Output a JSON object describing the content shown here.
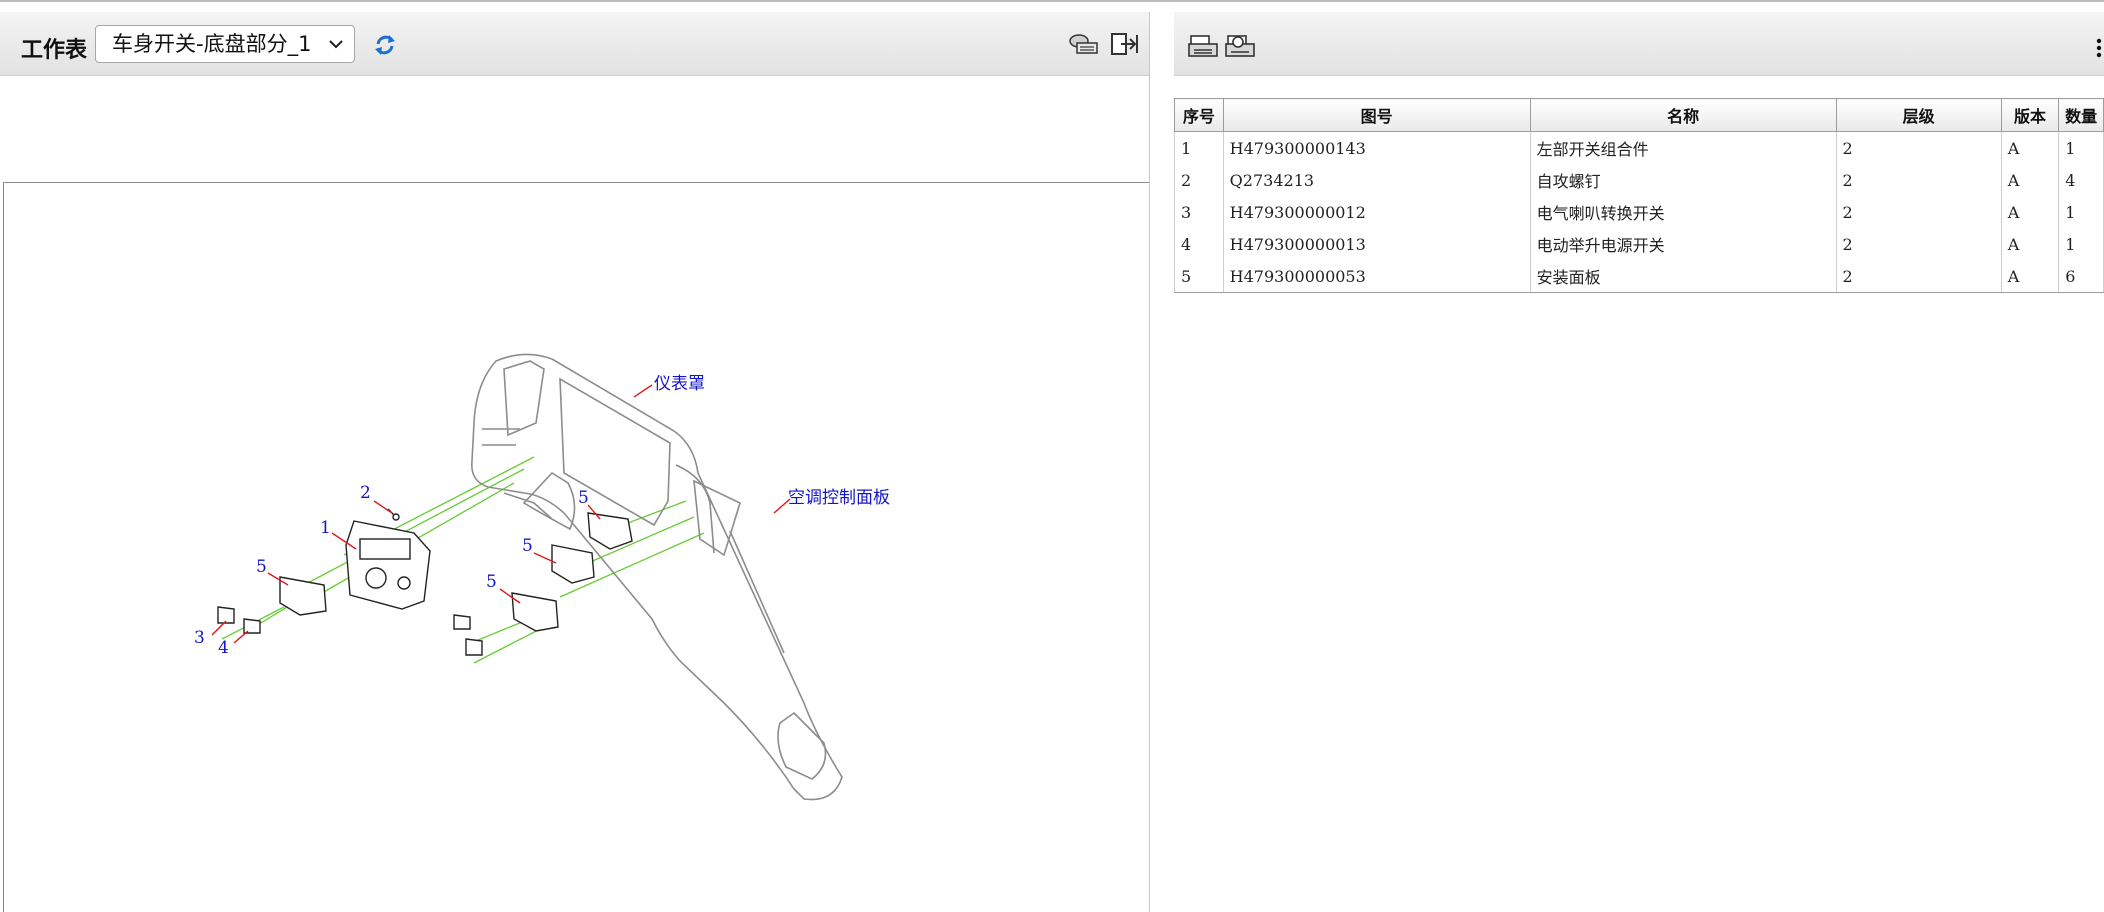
{
  "left_panel": {
    "worksheet_label": "工作表",
    "worksheet_selected": "车身开关-底盘部分_1",
    "icons": [
      "refresh-icon",
      "tool-icon",
      "export-icon"
    ]
  },
  "drawing": {
    "callouts": {
      "cover": "仪表罩",
      "ac_panel": "空调控制面板",
      "n1": "1",
      "n2": "2",
      "n3": "3",
      "n4": "4",
      "n5a": "5",
      "n5b": "5",
      "n5c": "5",
      "n5d": "5"
    },
    "callout_color": "#1414c8",
    "leader_color": "#e01818",
    "explode_line_color": "#66cc33"
  },
  "right_panel": {
    "icons": [
      "print-icon",
      "print-preview-icon",
      "more-icon"
    ]
  },
  "bom_table": {
    "columns": [
      "序号",
      "图号",
      "名称",
      "层级",
      "版本",
      "数量"
    ],
    "rows": [
      {
        "seq": "1",
        "part_no": "H479300000143",
        "name": "左部开关组合件",
        "level": "2",
        "version": "A",
        "qty": "1"
      },
      {
        "seq": "2",
        "part_no": "Q2734213",
        "name": "自攻螺钉",
        "level": "2",
        "version": "A",
        "qty": "4"
      },
      {
        "seq": "3",
        "part_no": "H479300000012",
        "name": "电气喇叭转换开关",
        "level": "2",
        "version": "A",
        "qty": "1"
      },
      {
        "seq": "4",
        "part_no": "H479300000013",
        "name": "电动举升电源开关",
        "level": "2",
        "version": "A",
        "qty": "1"
      },
      {
        "seq": "5",
        "part_no": "H479300000053",
        "name": "安装面板",
        "level": "2",
        "version": "A",
        "qty": "6"
      }
    ]
  }
}
